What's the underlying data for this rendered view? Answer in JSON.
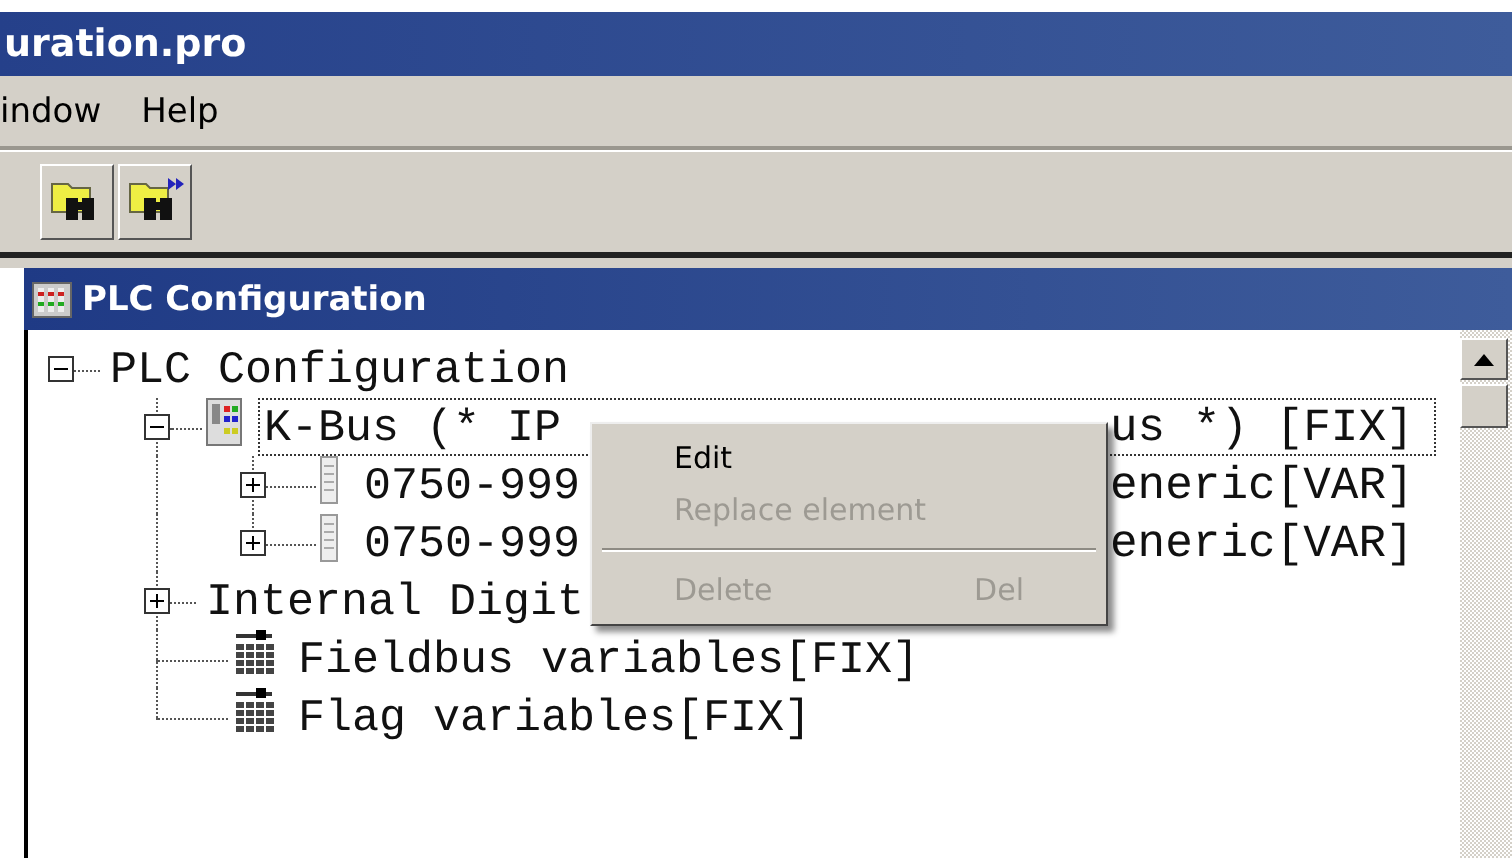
{
  "window": {
    "title": "uration.pro"
  },
  "menu_bar": [
    {
      "label": "indow"
    },
    {
      "label": "Help"
    }
  ],
  "panel": {
    "title": "PLC Configuration"
  },
  "tree": [
    {
      "label": "PLC Configuration",
      "kind": "plain",
      "expanded": true,
      "selected": false,
      "children": [
        {
          "label": "K-Bus (* IP",
          "label_tail": "us *) [FIX]",
          "kind": "kbus",
          "expanded": true,
          "selected": true,
          "children": [
            {
              "label": "0750-999",
              "label_tail": "eneric[VAR]",
              "kind": "module",
              "expanded": false,
              "selected": false
            },
            {
              "label": "0750-999",
              "label_tail": "eneric[VAR]",
              "kind": "module",
              "expanded": false,
              "selected": false
            }
          ]
        },
        {
          "label": "Internal Digit",
          "kind": "plain",
          "expanded": false,
          "selected": false
        },
        {
          "label": "Fieldbus variables[FIX]",
          "kind": "variables",
          "selected": false
        },
        {
          "label": "Flag variables[FIX]",
          "kind": "variables",
          "selected": false
        }
      ]
    }
  ],
  "context_menu": {
    "items": [
      {
        "kind": "item",
        "label": "Edit",
        "disabled": false
      },
      {
        "kind": "item",
        "label": "Replace element",
        "disabled": true
      },
      {
        "kind": "separator"
      },
      {
        "kind": "item",
        "label": "Delete",
        "shortcut": "Del",
        "disabled": true
      }
    ]
  }
}
